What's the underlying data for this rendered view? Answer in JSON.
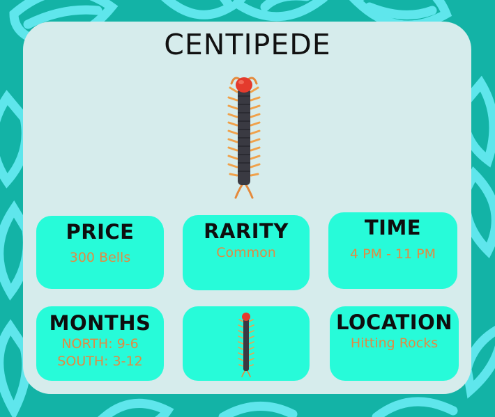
{
  "title": "CENTIPEDE",
  "hero_image": {
    "subject": "centipede"
  },
  "info": {
    "price": {
      "label": "PRICE",
      "value": "300 Bells"
    },
    "rarity": {
      "label": "RARITY",
      "value": "Common"
    },
    "time": {
      "label": "TIME",
      "value": "4 PM - 11 PM"
    },
    "months": {
      "label": "MONTHS",
      "north": "NORTH: 9-6",
      "south": "SOUTH: 3-12"
    },
    "location": {
      "label": "LOCATION",
      "value": "Hitting Rocks"
    }
  },
  "thumbnail": {
    "subject": "centipede"
  },
  "colors": {
    "background": "#13b3a6",
    "leaf_pattern": "#5fe6ec",
    "card": "#d6ecec",
    "tile": "#27fbd9",
    "label_text": "#0e0e0e",
    "value_text": "#e28a42",
    "centipede_body": "#3a3a42",
    "centipede_head": "#e43b2d",
    "centipede_legs": "#f0a14a"
  }
}
